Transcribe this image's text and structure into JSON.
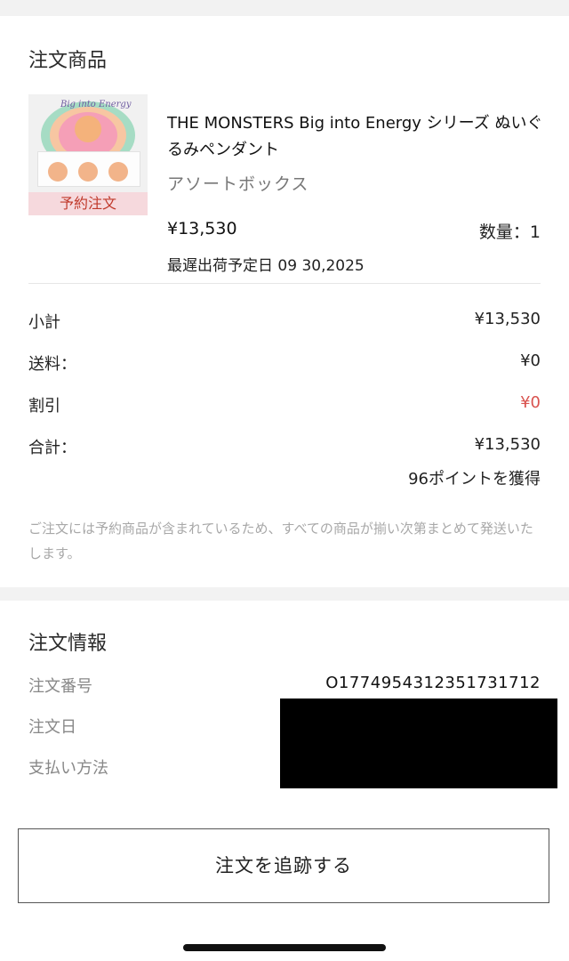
{
  "order_items": {
    "title": "注文商品",
    "product": {
      "image_text": "Big into Energy",
      "badge": "予約注文",
      "name": "THE MONSTERS Big into Energy シリーズ ぬいぐるみペンダント",
      "variant": "アソートボックス",
      "price": "¥13,530",
      "quantity": "数量：1",
      "ship_date": "最遅出荷予定日 09 30,2025"
    },
    "summary": [
      {
        "label": "小計",
        "value": "¥13,530"
      },
      {
        "label": "送料：",
        "value": "¥0"
      },
      {
        "label": "割引",
        "value": "¥0"
      },
      {
        "label": "合計：",
        "value": "¥13,530"
      }
    ],
    "points": "96ポイントを獲得",
    "note": "ご注文には予約商品が含まれているため、すべての商品が揃い次第まとめて発送いたします。"
  },
  "order_info": {
    "title": "注文情報",
    "order_number_label": "注文番号",
    "order_number": "O1774954312351731712",
    "order_date_label": "注文日",
    "payment_label": "支払い方法"
  },
  "footer": {
    "track_button": "注文を追跡する"
  },
  "colors": {
    "discount": "#d9534f",
    "badge_bg": "#f6d9dd",
    "badge_text": "#c0392b"
  }
}
